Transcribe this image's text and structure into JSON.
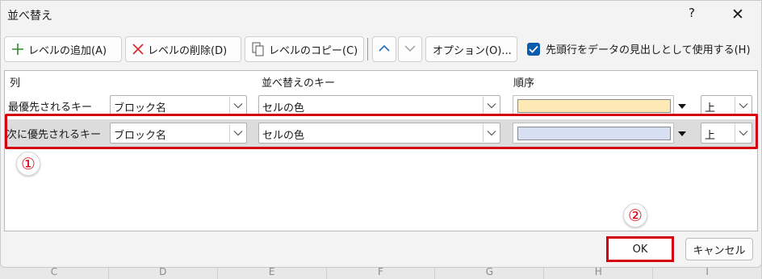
{
  "dialog": {
    "title": "並べ替え",
    "help_glyph": "?",
    "close_glyph": "✕"
  },
  "toolbar": {
    "add_level": "レベルの追加(A)",
    "delete_level": "レベルの削除(D)",
    "copy_level": "レベルのコピー(C)",
    "move_up_icon": "chevron-up-icon",
    "move_down_icon": "chevron-down-icon",
    "options": "オプション(O)...",
    "header_checkbox_label": "先頭行をデータの見出しとして使用する(H)",
    "header_checkbox_checked": true
  },
  "table": {
    "headers": {
      "column": "列",
      "sort_on": "並べ替えのキー",
      "order": "順序"
    },
    "rows": [
      {
        "label": "最優先されるキー",
        "column": "ブロック名",
        "sort_on": "セルの色",
        "color": "#fde9b3",
        "position": "上",
        "selected": false
      },
      {
        "label": "次に優先されるキー",
        "column": "ブロック名",
        "sort_on": "セルの色",
        "color": "#d6e0f2",
        "position": "上",
        "selected": true
      }
    ]
  },
  "annotations": {
    "marker1": "①",
    "marker2": "②",
    "highlight_color": "#d7000f"
  },
  "footer": {
    "ok": "OK",
    "cancel": "キャンセル"
  },
  "sheet_columns": [
    "C",
    "D",
    "E",
    "F",
    "G",
    "H",
    "I"
  ]
}
